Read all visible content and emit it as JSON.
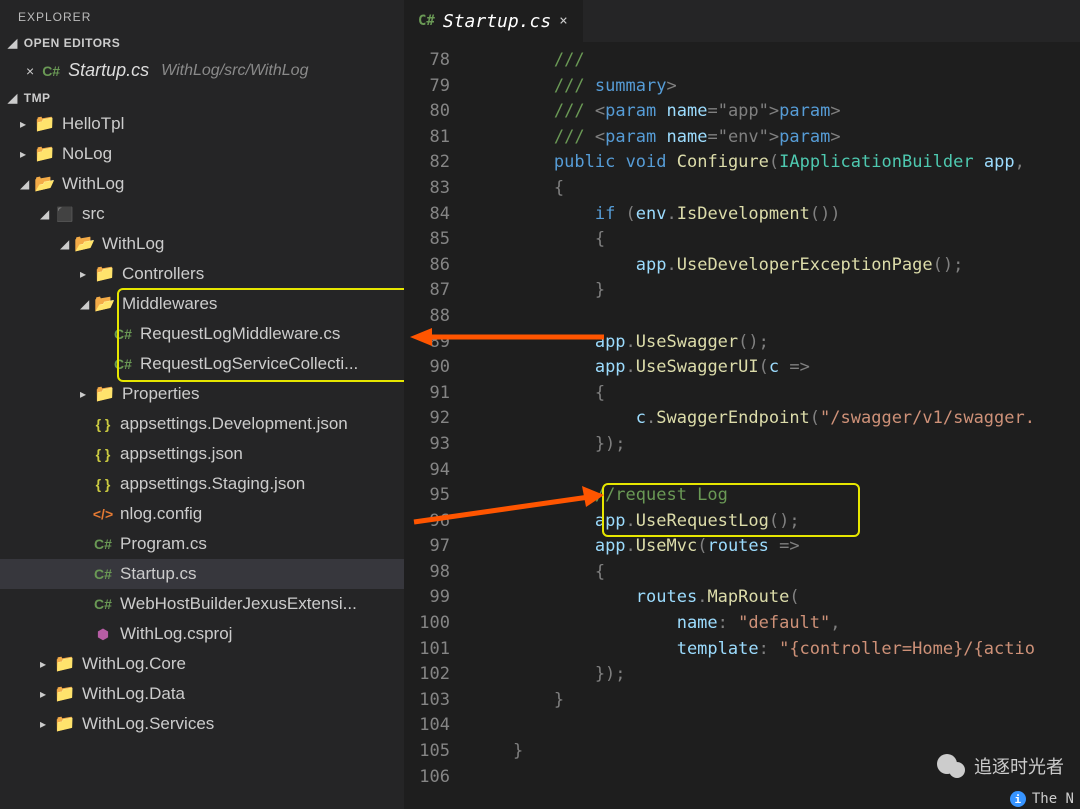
{
  "explorer": {
    "title": "EXPLORER",
    "openEditorsLabel": "OPEN EDITORS",
    "openFile": {
      "name": "Startup.cs",
      "path": "WithLog/src/WithLog"
    },
    "workspaceLabel": "TMP",
    "tree": {
      "helloTpl": "HelloTpl",
      "noLog": "NoLog",
      "withLog": "WithLog",
      "src": "src",
      "withLog2": "WithLog",
      "controllers": "Controllers",
      "middlewares": "Middlewares",
      "mw1": "RequestLogMiddleware.cs",
      "mw2": "RequestLogServiceCollecti...",
      "properties": "Properties",
      "appdev": "appsettings.Development.json",
      "app": "appsettings.json",
      "appstg": "appsettings.Staging.json",
      "nlog": "nlog.config",
      "program": "Program.cs",
      "startup": "Startup.cs",
      "webhost": "WebHostBuilderJexusExtensi...",
      "csproj": "WithLog.csproj",
      "core": "WithLog.Core",
      "data": "WithLog.Data",
      "services": "WithLog.Services"
    }
  },
  "tab": {
    "name": "Startup.cs"
  },
  "csLabel": "C#",
  "braceLabel": "{ }",
  "xmlLabel": "</>",
  "gutter": [
    "78",
    "79",
    "80",
    "81",
    "82",
    "83",
    "84",
    "85",
    "86",
    "87",
    "88",
    "89",
    "90",
    "91",
    "92",
    "93",
    "94",
    "95",
    "96",
    "97",
    "98",
    "99",
    "100",
    "101",
    "102",
    "103",
    "104",
    "105",
    "106"
  ],
  "code": {
    "l78": "        /// ",
    "l79a": "        /// ",
    "l79b": "</",
    "l79c": "summary",
    "l79d": ">",
    "l80a": "        /// ",
    "l80b": "<",
    "l80c": "param",
    "l80d": " name",
    "l80e": "=",
    "l80f": "\"app\"",
    "l80g": "></",
    "l80h": "param",
    "l80i": ">",
    "l81a": "        /// ",
    "l81b": "<",
    "l81c": "param",
    "l81d": " name",
    "l81e": "=",
    "l81f": "\"env\"",
    "l81g": "></",
    "l81h": "param",
    "l81i": ">",
    "l82a": "        ",
    "l82b": "public",
    "l82c": " ",
    "l82d": "void",
    "l82e": " ",
    "l82f": "Configure",
    "l82g": "(",
    "l82h": "IApplicationBuilder",
    "l82i": " ",
    "l82j": "app",
    "l82k": ", ",
    "l83": "        {",
    "l84a": "            ",
    "l84b": "if",
    "l84c": " (",
    "l84d": "env",
    "l84e": ".",
    "l84f": "IsDevelopment",
    "l84g": "())",
    "l85": "            {",
    "l86a": "                ",
    "l86b": "app",
    "l86c": ".",
    "l86d": "UseDeveloperExceptionPage",
    "l86e": "();",
    "l87": "            }",
    "l88": "",
    "l89a": "            ",
    "l89b": "app",
    "l89c": ".",
    "l89d": "UseSwagger",
    "l89e": "();",
    "l90a": "            ",
    "l90b": "app",
    "l90c": ".",
    "l90d": "UseSwaggerUI",
    "l90e": "(",
    "l90f": "c",
    "l90g": " =>",
    "l91": "            {",
    "l92a": "                ",
    "l92b": "c",
    "l92c": ".",
    "l92d": "SwaggerEndpoint",
    "l92e": "(",
    "l92f": "\"/swagger/v1/swagger.",
    "l93": "            });",
    "l94": "",
    "l95a": "            ",
    "l95b": "//request Log",
    "l96a": "            ",
    "l96b": "app",
    "l96c": ".",
    "l96d": "UseRequestLog",
    "l96e": "();",
    "l97a": "            ",
    "l97b": "app",
    "l97c": ".",
    "l97d": "UseMvc",
    "l97e": "(",
    "l97f": "routes",
    "l97g": " =>",
    "l98": "            {",
    "l99a": "                ",
    "l99b": "routes",
    "l99c": ".",
    "l99d": "MapRoute",
    "l99e": "(",
    "l100a": "                    ",
    "l100b": "name",
    "l100c": ": ",
    "l100d": "\"default\"",
    "l100e": ",",
    "l101a": "                    ",
    "l101b": "template",
    "l101c": ": ",
    "l101d": "\"{controller=Home}/{actio",
    "l102": "            });",
    "l103": "        }",
    "l104": "",
    "l105": "    }",
    "l106": ""
  },
  "watermark": "追逐时光者",
  "status": "The N"
}
